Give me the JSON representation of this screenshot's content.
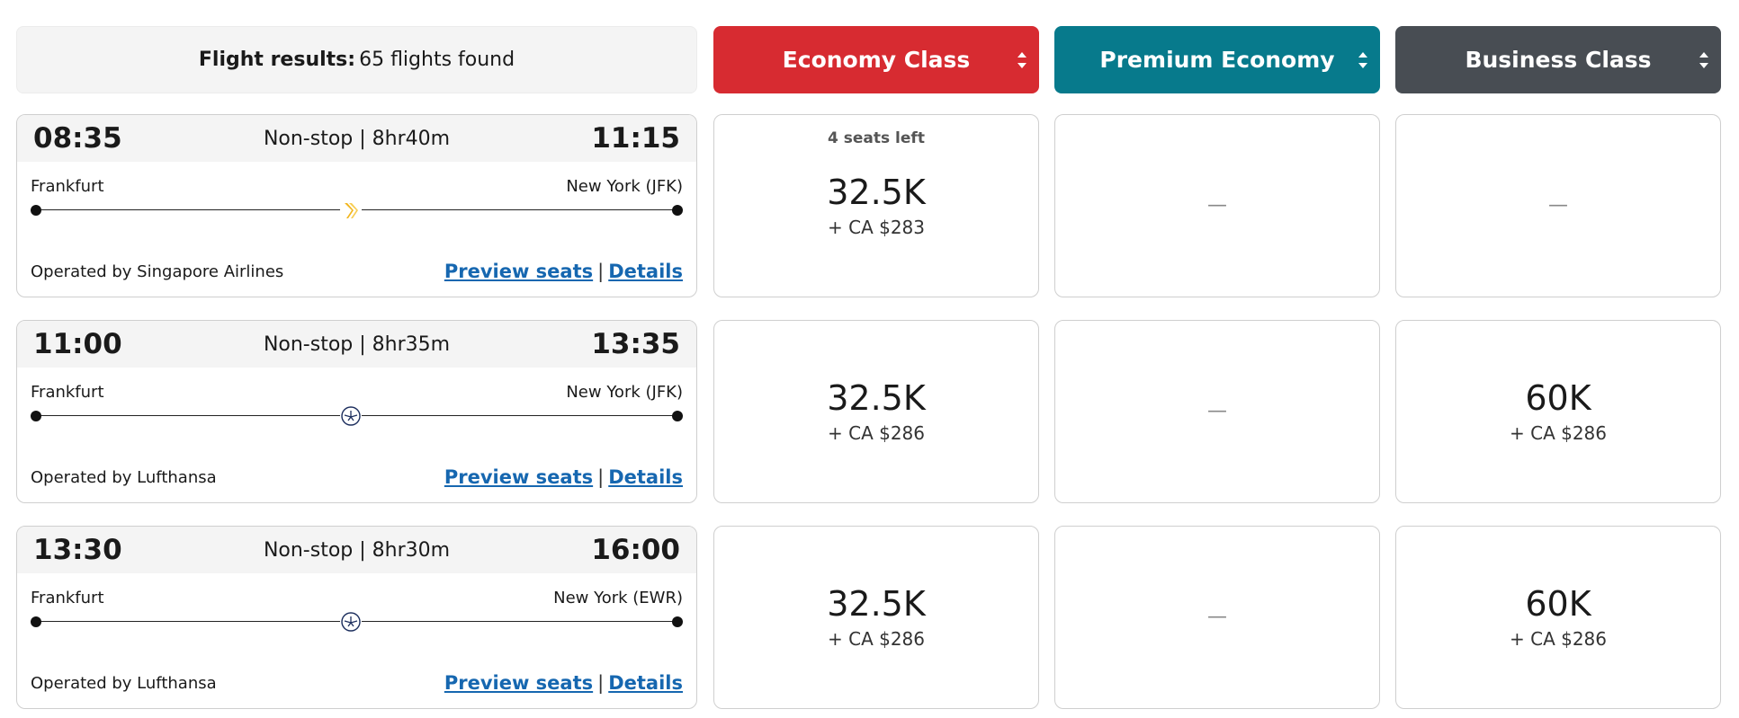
{
  "results": {
    "label": "Flight results:",
    "value": "65 flights found"
  },
  "cabins": [
    {
      "label": "Economy Class",
      "color": "#d72b31",
      "sort_icon": "sort-arrows-icon"
    },
    {
      "label": "Premium Economy",
      "color": "#077a8c",
      "sort_icon": "sort-arrows-icon"
    },
    {
      "label": "Business Class",
      "color": "#484d53",
      "sort_icon": "sort-arrows-icon"
    }
  ],
  "links": {
    "preview": "Preview seats",
    "separator": "|",
    "details": "Details"
  },
  "flights": [
    {
      "depart": "08:35",
      "arrive": "11:15",
      "stops": "Non-stop | 8hr40m",
      "from": "Frankfurt",
      "to": "New York (JFK)",
      "operator": "Operated by Singapore Airlines",
      "airline_icon": "singapore-airlines-logo-icon",
      "fares": [
        {
          "seats": "4 seats left",
          "points": "32.5K",
          "cash": "+ CA $283"
        },
        {
          "na": "—"
        },
        {
          "na": "—"
        }
      ]
    },
    {
      "depart": "11:00",
      "arrive": "13:35",
      "stops": "Non-stop | 8hr35m",
      "from": "Frankfurt",
      "to": "New York (JFK)",
      "operator": "Operated by Lufthansa",
      "airline_icon": "lufthansa-logo-icon",
      "fares": [
        {
          "points": "32.5K",
          "cash": "+ CA $286"
        },
        {
          "na": "—"
        },
        {
          "points": "60K",
          "cash": "+ CA $286"
        }
      ]
    },
    {
      "depart": "13:30",
      "arrive": "16:00",
      "stops": "Non-stop | 8hr30m",
      "from": "Frankfurt",
      "to": "New York (EWR)",
      "operator": "Operated by Lufthansa",
      "airline_icon": "lufthansa-logo-icon",
      "fares": [
        {
          "points": "32.5K",
          "cash": "+ CA $286"
        },
        {
          "na": "—"
        },
        {
          "points": "60K",
          "cash": "+ CA $286"
        }
      ]
    }
  ]
}
